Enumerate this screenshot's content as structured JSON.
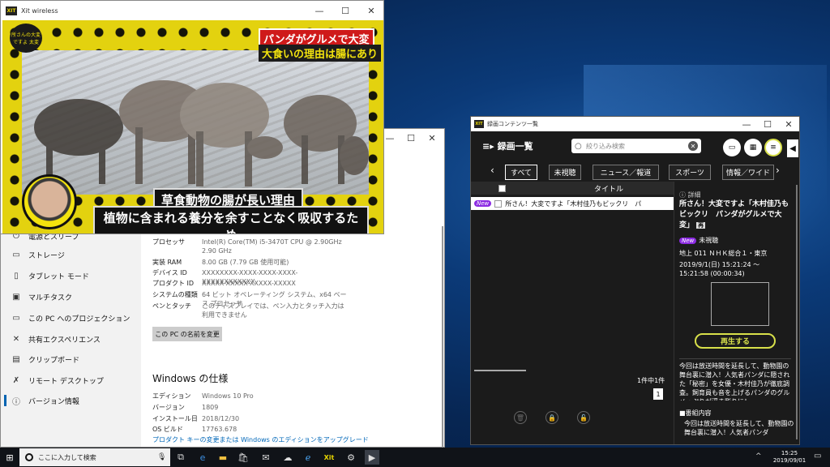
{
  "settings": {
    "nav": [
      {
        "icon": "power-icon",
        "label": "電源とスリープ"
      },
      {
        "icon": "storage-icon",
        "label": "ストレージ"
      },
      {
        "icon": "tablet-icon",
        "label": "タブレット モード"
      },
      {
        "icon": "multitask-icon",
        "label": "マルチタスク"
      },
      {
        "icon": "projection-icon",
        "label": "この PC へのプロジェクション"
      },
      {
        "icon": "shared-icon",
        "label": "共有エクスペリエンス"
      },
      {
        "icon": "clipboard-icon",
        "label": "クリップボード"
      },
      {
        "icon": "remote-icon",
        "label": "リモート デスクトップ"
      },
      {
        "icon": "info-icon",
        "label": "バージョン情報"
      }
    ],
    "device_specs": [
      {
        "k": "プロセッサ",
        "v": "Intel(R) Core(TM) i5-3470T CPU @ 2.90GHz   2.90 GHz"
      },
      {
        "k": "実装 RAM",
        "v": "8.00 GB (7.79 GB 使用可能)"
      },
      {
        "k": "デバイス ID",
        "v": "XXXXXXXX-XXXX-XXXX-XXXX-XXXXXXXXXXXX"
      },
      {
        "k": "プロダクト ID",
        "v": "XXXXX-XXXXX-XXXXX-XXXXX"
      },
      {
        "k": "システムの種類",
        "v": "64 ビット オペレーティング システム、x64 ベース プロセッサ"
      },
      {
        "k": "ペンとタッチ",
        "v": "このディスプレイでは、ペン入力とタッチ入力は利用できません"
      }
    ],
    "rename_button": "この PC の名前を変更",
    "windows_spec_heading": "Windows の仕様",
    "windows_specs": [
      {
        "k": "エディション",
        "v": "Windows 10 Pro"
      },
      {
        "k": "バージョン",
        "v": "1809"
      },
      {
        "k": "インストール日",
        "v": "2018/12/30"
      },
      {
        "k": "OS ビルド",
        "v": "17763.678"
      }
    ],
    "link": "プロダクト キーの変更または Windows のエディションをアップグレード"
  },
  "video": {
    "title": "Xit wireless",
    "logo": "XIT",
    "channel_logo": "所さんの大変ですよ 太変",
    "caption_red": "パンダがグルメで大変",
    "caption_yellow": "大食いの理由は腸にあり",
    "subtitle1": "草食動物の腸が長い理由",
    "subtitle2": "植物に含まれる養分を余すことなく吸収するため"
  },
  "recorder": {
    "title": "録画コンテンツ一覧",
    "list_label": "録画一覧",
    "search_placeholder": "絞り込み検索",
    "tabs": [
      "すべて",
      "未視聴",
      "ニュース／報道",
      "スポーツ",
      "情報／ワイド"
    ],
    "column_title": "タイトル",
    "rows": [
      {
        "badge": "New",
        "title": "所さん！大変ですよ「木村佳乃もビックリ　パ"
      }
    ],
    "count": "1件中1件",
    "page": "1",
    "detail": {
      "label": "詳細",
      "title": "所さん！大変ですよ「木村佳乃もビックリ　パンダがグルメで大変」",
      "tag": "再",
      "badge": "New",
      "unwatched": "未視聴",
      "channel": "地上 011 ＮＨＫ総合１・東京",
      "datetime": "2019/9/1(日) 15:21:24 ～",
      "datetime2": "15:21:58 (00:00:34)",
      "play_button": "再生する",
      "summary": "今回は放送時間を延長して、動物園の舞台裏に潜入！人気者パンダに隠された「秘密」を女優・木村佳乃が徹底調査。飼育員も音を上げるパンダのグルメっぷりが浮き彫りに！",
      "section_label": "■番組内容",
      "section_text": "今回は放送時間を延長して、動物園の舞台裏に潜入！人気者パンダ"
    }
  },
  "taskbar": {
    "search_placeholder": "ここに入力して検索",
    "app_icons": [
      "task-view-icon",
      "edge-icon",
      "explorer-icon",
      "store-icon",
      "mail-icon",
      "photos-icon",
      "ie-icon",
      "xit-icon",
      "settings-icon",
      "xit-player-icon"
    ],
    "time": "15:25",
    "date": "2019/09/01"
  }
}
